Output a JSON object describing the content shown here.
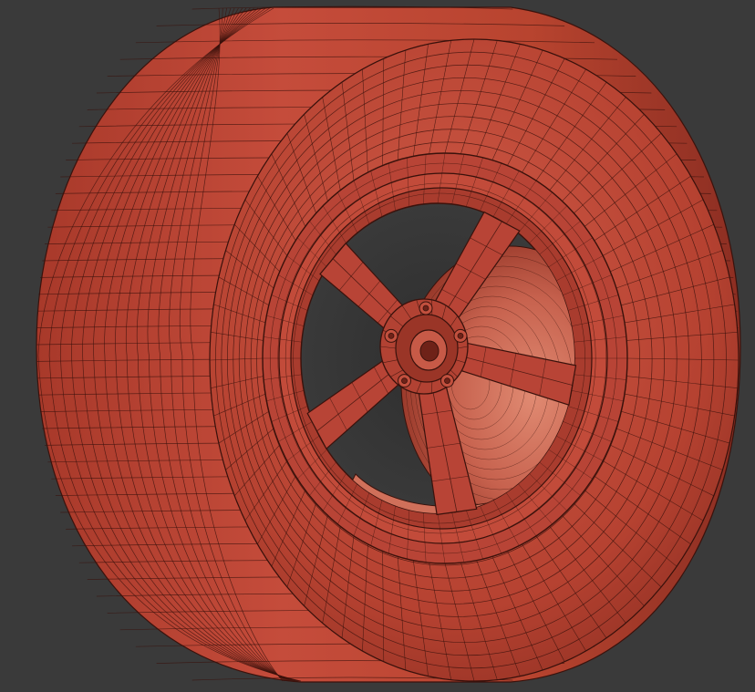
{
  "viewport": {
    "background_color": "#3a3a3a",
    "subject": "wheel-wireframe-model",
    "shading": "clay",
    "wire_overlay": true
  },
  "colors": {
    "tire_base": "#c4483a",
    "tire_dark": "#7e2519",
    "tire_highlight": "#d86a58",
    "wire": "#3a120c",
    "rim_base": "#b84436",
    "hub_base": "#a63b2e"
  },
  "wheel": {
    "spoke_count": 5,
    "lug_count": 5
  }
}
